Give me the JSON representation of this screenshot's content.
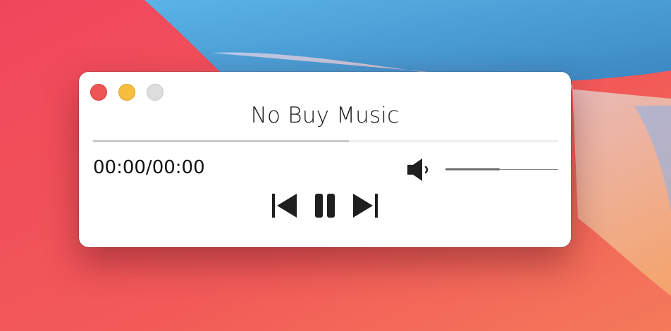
{
  "window": {
    "title": "No Buy Music",
    "controls": [
      "close",
      "minimize",
      "zoom"
    ]
  },
  "player": {
    "time_display": "00:00/00:00",
    "progress_fraction": 0.55,
    "volume_fraction": 0.48,
    "buttons": {
      "previous_icon": "skip-previous-icon",
      "pause_icon": "pause-icon",
      "next_icon": "skip-next-icon",
      "volume_icon": "speaker-icon"
    }
  },
  "colors": {
    "close": "#ee5557",
    "minimize": "#f6bd3e",
    "zoom_inactive": "#dddddd",
    "icon": "#1f1f1f"
  }
}
